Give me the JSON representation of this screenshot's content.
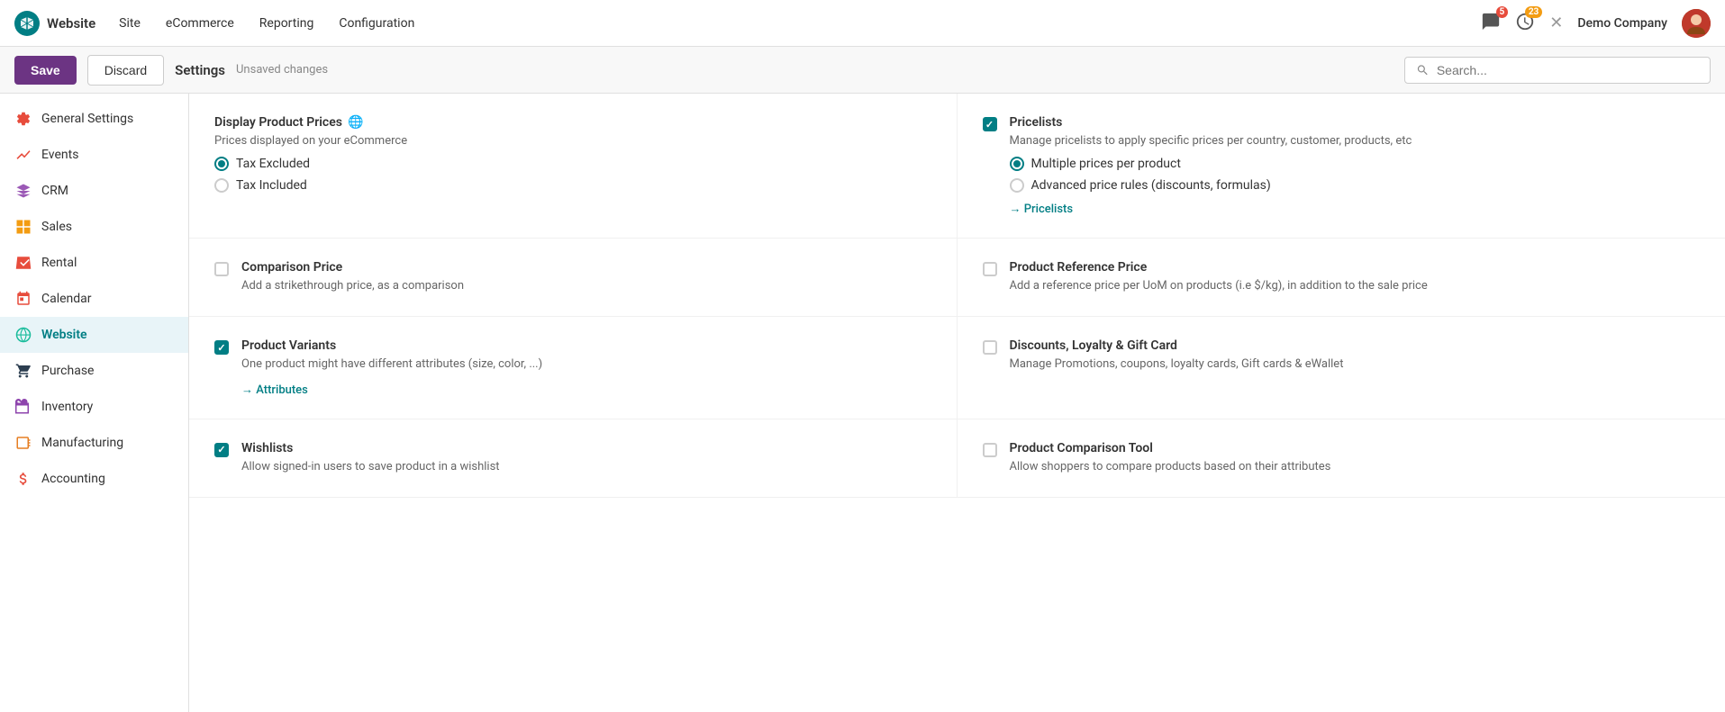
{
  "app": {
    "logo_text": "Website",
    "nav_items": [
      "Site",
      "eCommerce",
      "Reporting",
      "Configuration"
    ],
    "company": "Demo Company",
    "notifications_count": "5",
    "activity_count": "23"
  },
  "toolbar": {
    "save_label": "Save",
    "discard_label": "Discard",
    "title": "Settings",
    "unsaved": "Unsaved changes",
    "search_placeholder": "Search..."
  },
  "sidebar": {
    "items": [
      {
        "label": "General Settings",
        "color": "#e74c3c"
      },
      {
        "label": "Events",
        "color": "#e74c3c"
      },
      {
        "label": "CRM",
        "color": "#9b59b6"
      },
      {
        "label": "Sales",
        "color": "#f39c12"
      },
      {
        "label": "Rental",
        "color": "#e74c3c"
      },
      {
        "label": "Calendar",
        "color": "#e74c3c"
      },
      {
        "label": "Website",
        "color": "#1abc9c",
        "active": true
      },
      {
        "label": "Purchase",
        "color": "#2c3e50"
      },
      {
        "label": "Inventory",
        "color": "#8e44ad"
      },
      {
        "label": "Manufacturing",
        "color": "#e67e22"
      },
      {
        "label": "Accounting",
        "color": "#e74c3c"
      }
    ]
  },
  "settings": {
    "display_product_prices": {
      "title": "Display Product Prices",
      "globe": "🌐",
      "desc": "Prices displayed on your eCommerce",
      "tax_excluded": "Tax Excluded",
      "tax_included": "Tax Included",
      "tax_excluded_selected": true,
      "tax_included_selected": false
    },
    "pricelists": {
      "title": "Pricelists",
      "checked": true,
      "desc": "Manage pricelists to apply specific prices per country, customer, products, etc",
      "option_multiple": "Multiple prices per product",
      "option_advanced": "Advanced price rules (discounts, formulas)",
      "multiple_selected": true,
      "advanced_selected": false,
      "link": "Pricelists"
    },
    "comparison_price": {
      "title": "Comparison Price",
      "desc": "Add a strikethrough price, as a comparison",
      "checked": false
    },
    "product_reference_price": {
      "title": "Product Reference Price",
      "desc": "Add a reference price per UoM on products (i.e $/kg), in addition to the sale price",
      "checked": false
    },
    "product_variants": {
      "title": "Product Variants",
      "desc": "One product might have different attributes (size, color, ...)",
      "checked": true,
      "link": "Attributes"
    },
    "discounts": {
      "title": "Discounts, Loyalty & Gift Card",
      "desc": "Manage Promotions, coupons, loyalty cards, Gift cards & eWallet",
      "checked": false
    },
    "wishlists": {
      "title": "Wishlists",
      "desc": "Allow signed-in users to save product in a wishlist",
      "checked": true
    },
    "product_comparison": {
      "title": "Product Comparison Tool",
      "desc": "Allow shoppers to compare products based on their attributes",
      "checked": false
    }
  }
}
